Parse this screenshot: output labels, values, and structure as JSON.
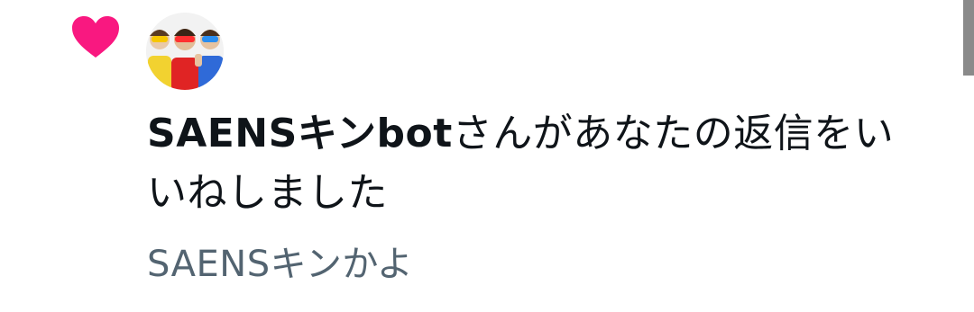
{
  "notification": {
    "type_icon": "heart-icon",
    "type_icon_color": "#f91880",
    "avatar": "group-photo-avatar",
    "actor_name": "SAENSキンbot",
    "action_text": "さんがあなたの返信をいいねしました",
    "preview_text": "SAENSキンかよ"
  },
  "colors": {
    "primary_text": "#0f1419",
    "secondary_text": "#536471",
    "like": "#f91880"
  }
}
